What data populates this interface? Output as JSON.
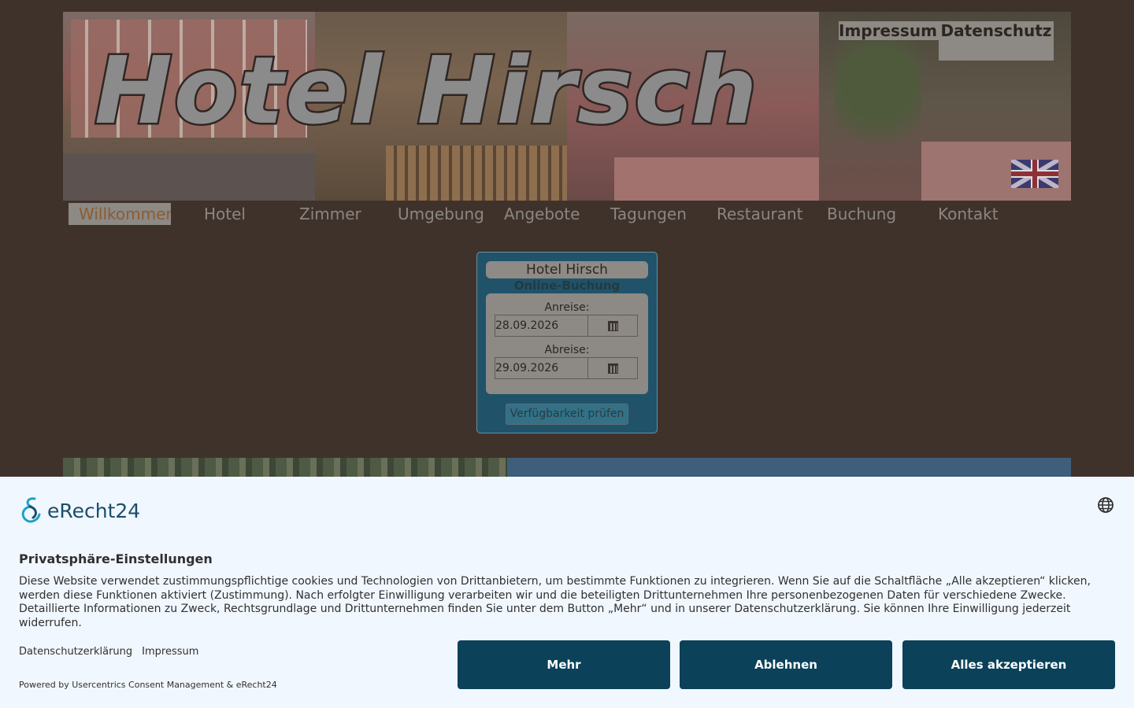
{
  "header": {
    "title": "Hotel Hirsch",
    "links": {
      "impressum": "Impressum",
      "datenschutz": "Datenschutz"
    },
    "language_flag": "uk-flag-icon"
  },
  "nav": {
    "items": [
      {
        "label": "Willkommen",
        "active": true
      },
      {
        "label": "Hotel"
      },
      {
        "label": "Zimmer"
      },
      {
        "label": "Umgebung"
      },
      {
        "label": "Angebote"
      },
      {
        "label": "Tagungen"
      },
      {
        "label": "Restaurant"
      },
      {
        "label": "Buchung"
      },
      {
        "label": "Kontakt"
      }
    ]
  },
  "booking": {
    "title": "Hotel Hirsch",
    "subtitle": "Online-Buchung",
    "arrival_label": "Anreise:",
    "arrival_value": "28.09.2026",
    "departure_label": "Abreise:",
    "departure_value": "29.09.2026",
    "check_button": "Verfügbarkeit prüfen"
  },
  "consent": {
    "brand": "eRecht24",
    "title": "Privatsphäre-Einstellungen",
    "text": "Diese Website verwendet zustimmungspflichtige cookies und Technologien von Drittanbietern, um bestimmte Funktionen zu integrieren. Wenn Sie auf die Schaltfläche „Alle akzeptieren“ klicken, werden diese Funktionen aktiviert (Zustimmung). Nach erfolgter Einwilligung verarbeiten wir und die beteiligten Drittunternehmen Ihre personenbezogenen Daten für verschiedene Zwecke. Detaillierte Informationen zu Zweck, Rechtsgrundlage und Drittunternehmen finden Sie unter dem Button „Mehr“ und in unserer Datenschutzerklärung. Sie können Ihre Einwilligung jederzeit widerrufen.",
    "link_privacy": "Datenschutzerklärung",
    "link_imprint": "Impressum",
    "powered": "Powered by Usercentrics Consent Management & eRecht24",
    "btn_more": "Mehr",
    "btn_decline": "Ablehnen",
    "btn_accept": "Alles akzeptieren"
  },
  "colors": {
    "page_bg": "#3f322b",
    "consent_bg": "#f1f7fe",
    "consent_button": "#0b4159",
    "booking_bg": "#20536a"
  }
}
